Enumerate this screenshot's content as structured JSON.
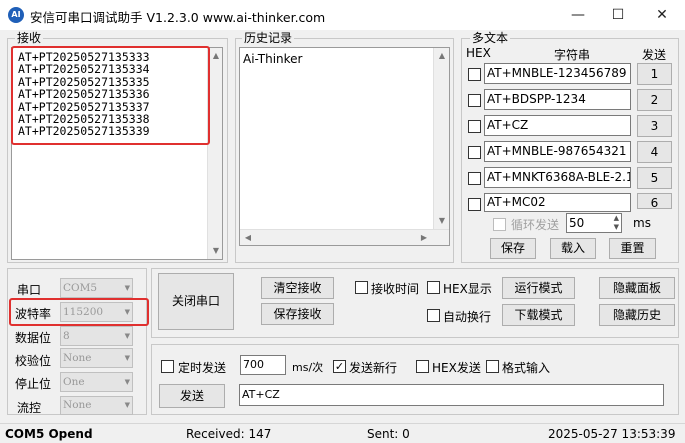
{
  "window": {
    "title": "安信可串口调试助手 V1.2.3.0     www.ai-thinker.com",
    "icon_text": "AI",
    "minimize_glyph": "—",
    "maximize_glyph": "☐",
    "close_glyph": "✕"
  },
  "receive": {
    "label": "接收",
    "lines": [
      "AT+PT20250527135333",
      "AT+PT20250527135334",
      "AT+PT20250527135335",
      "AT+PT20250527135336",
      "AT+PT20250527135337",
      "AT+PT20250527135338",
      "AT+PT20250527135339"
    ]
  },
  "history": {
    "label": "历史记录",
    "items": [
      "Ai-Thinker"
    ]
  },
  "multitext": {
    "label": "多文本",
    "col_hex": "HEX",
    "col_string": "字符串",
    "col_send": "发送",
    "rows": [
      {
        "value": "AT+MNBLE-123456789",
        "button": "1"
      },
      {
        "value": "AT+BDSPP-1234",
        "button": "2"
      },
      {
        "value": "AT+CZ",
        "button": "3"
      },
      {
        "value": "AT+MNBLE-987654321",
        "button": "4"
      },
      {
        "value": "AT+MNKT6368A-BLE-2.1",
        "button": "5"
      },
      {
        "value": "AT+MC02",
        "button": "6"
      }
    ],
    "loop_send_label": "循环发送",
    "loop_interval": "50",
    "loop_unit": "ms",
    "save_label": "保存",
    "load_label": "载入",
    "reset_label": "重置"
  },
  "port": {
    "port_label": "串口",
    "port_value": "COM5",
    "baud_label": "波特率",
    "baud_value": "115200",
    "databits_label": "数据位",
    "databits_value": "8",
    "parity_label": "校验位",
    "parity_value": "None",
    "stopbits_label": "停止位",
    "stopbits_value": "One",
    "flow_label": "流控",
    "flow_value": "None",
    "close_port_label": "关闭串口"
  },
  "controls": {
    "clear_receive_label": "清空接收",
    "save_receive_label": "保存接收",
    "receive_time_label": "接收时间",
    "hex_display_label": "HEX显示",
    "auto_wrap_label": "自动换行",
    "run_mode_label": "运行模式",
    "download_mode_label": "下载模式",
    "hide_panel_label": "隐藏面板",
    "hide_history_label": "隐藏历史"
  },
  "send": {
    "timed_send_label": "定时发送",
    "interval_value": "700",
    "interval_unit": "ms/次",
    "send_newline_label": "发送新行",
    "send_newline_checked": "✓",
    "hex_send_label": "HEX发送",
    "format_input_label": "格式输入",
    "send_button_label": "发送",
    "send_text": "AT+CZ"
  },
  "status": {
    "port_state": "COM5 Opend",
    "received": "Received: 147",
    "sent": "Sent: 0",
    "datetime": "2025-05-27 13:53:39"
  },
  "colors": {
    "highlight_red": "#e0302f",
    "icon_blue": "#1f5fb8"
  }
}
